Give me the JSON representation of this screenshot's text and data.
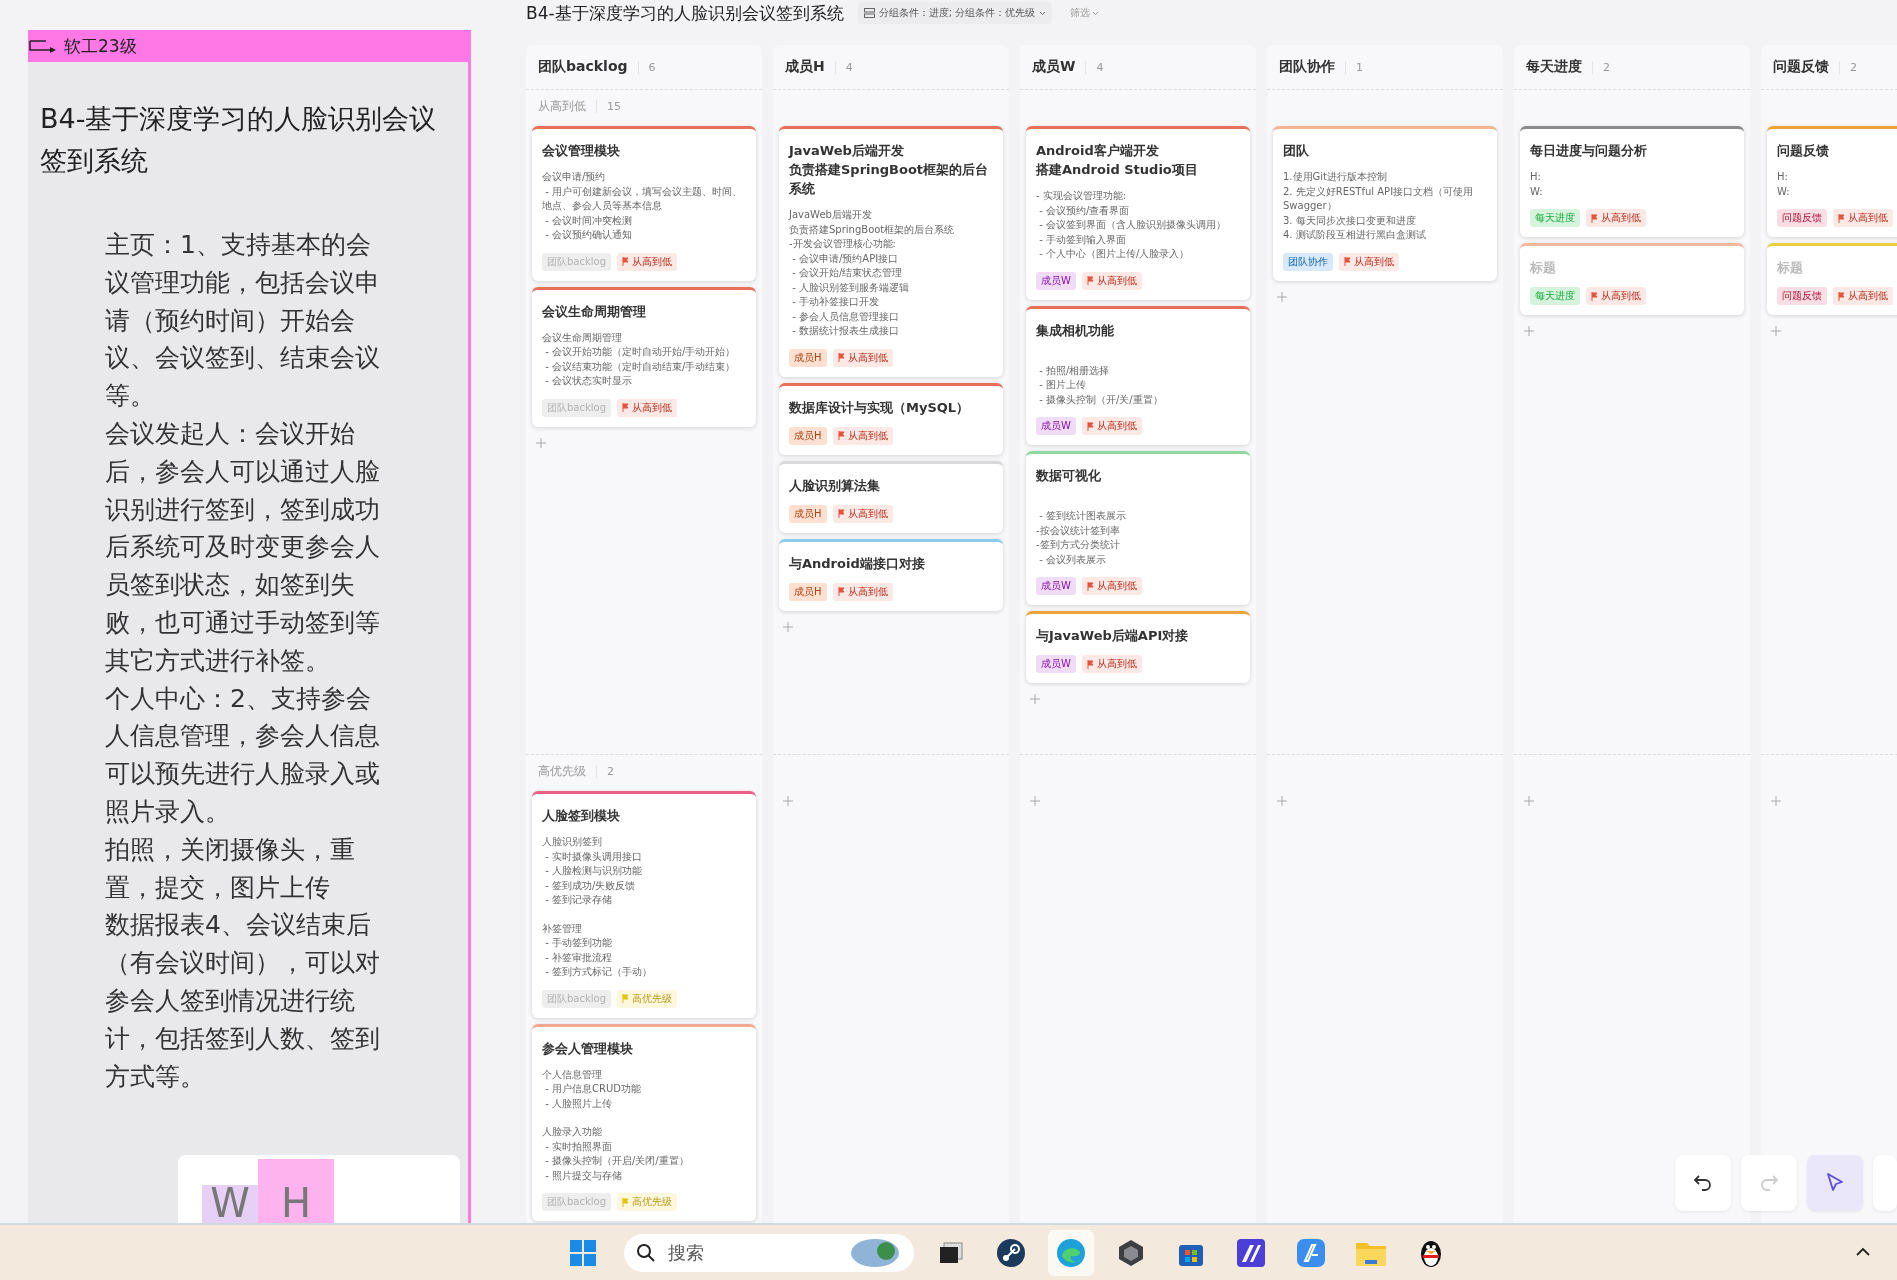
{
  "note_panel": {
    "header": "软工23级",
    "title": "B4-基于深度学习的人脸识别会议签到系统",
    "paragraphs": [
      "主页：1、支持基本的会议管理功能，包括会议申请（预约时间）开始会议、会议签到、结束会议等。",
      "会议发起人：会议开始后，参会人可以通过人脸识别进行签到，签到成功后系统可及时变更参会人员签到状态，如签到失败，也可通过手动签到等其它方式进行补签。",
      "个人中心：2、支持参会人信息管理，参会人信息可以预先进行人脸录入或照片录入。",
      "拍照，关闭摄像头，重置，提交，图片上传",
      "数据报表4、会议结束后（有会议时间），可以对参会人签到情况进行统计，包括签到人数、签到方式等。"
    ],
    "stickies": [
      {
        "label": "W",
        "color": "#e6d0f5"
      },
      {
        "label": "H",
        "color": "#ffb3ee"
      }
    ]
  },
  "board": {
    "title": "B4-基于深度学习的人脸识别会议签到系统",
    "group_by": "分组条件：进度; 分组条件：优先级",
    "filter": "筛选",
    "columns": [
      {
        "name": "团队backlog",
        "count": "6"
      },
      {
        "name": "成员H",
        "count": "4"
      },
      {
        "name": "成员W",
        "count": "4"
      },
      {
        "name": "团队协作",
        "count": "1"
      },
      {
        "name": "每天进度",
        "count": "2"
      },
      {
        "name": "问题反馈",
        "count": "2"
      }
    ],
    "lanes": [
      {
        "name": "从高到低",
        "count": "15",
        "cells": [
          [
            {
              "title": [
                "会议管理模块"
              ],
              "color": "#e8705a",
              "body": [
                [
                  "会议申请/预约",
                  " - 用户可创建新会议，填写会议主题、时间、地点、参会人员等基本信息",
                  " - 会议时间冲突检测",
                  " - 会议预约确认通知"
                ]
              ],
              "tags": [
                {
                  "kind": "group",
                  "label": "团队backlog",
                  "color": "#eeeeee"
                },
                {
                  "kind": "priority",
                  "label": "从高到低",
                  "color": "#e5533d"
                }
              ]
            },
            {
              "title": [
                "会议生命周期管理"
              ],
              "color": "#e8705a",
              "body": [
                [
                  "会议生命周期管理",
                  " - 会议开始功能（定时自动开始/手动开始）",
                  " - 会议结束功能（定时自动结束/手动结束）",
                  " - 会议状态实时显示"
                ]
              ],
              "tags": [
                {
                  "kind": "group",
                  "label": "团队backlog",
                  "color": "#eeeeee"
                },
                {
                  "kind": "priority",
                  "label": "从高到低",
                  "color": "#e5533d"
                }
              ]
            }
          ],
          [
            {
              "title": [
                "JavaWeb后端开发",
                "负责搭建SpringBoot框架的后台系统"
              ],
              "color": "#e8705a",
              "body": [
                [
                  "JavaWeb后端开发",
                  "负责搭建SpringBoot框架的后台系统",
                  "-开发会议管理核心功能:",
                  " - 会议申请/预约API接口",
                  " - 会议开始/结束状态管理",
                  " - 人脸识别签到服务端逻辑",
                  " - 手动补签接口开发",
                  " - 参会人员信息管理接口",
                  " - 数据统计报表生成接口"
                ]
              ],
              "tags": [
                {
                  "kind": "group",
                  "label": "成员H",
                  "color": "#fde0d2"
                },
                {
                  "kind": "priority",
                  "label": "从高到低",
                  "color": "#e5533d"
                }
              ]
            },
            {
              "title": [
                "数据库设计与实现（MySQL）"
              ],
              "color": "#e8705a",
              "tags": [
                {
                  "kind": "group",
                  "label": "成员H",
                  "color": "#fde0d2"
                },
                {
                  "kind": "priority",
                  "label": "从高到低",
                  "color": "#e5533d"
                }
              ]
            },
            {
              "title": [
                "人脸识别算法集"
              ],
              "color": "#d8d8d8",
              "tags": [
                {
                  "kind": "group",
                  "label": "成员H",
                  "color": "#fde0d2"
                },
                {
                  "kind": "priority",
                  "label": "从高到低",
                  "color": "#e5533d"
                }
              ]
            },
            {
              "title": [
                "与Android端接口对接"
              ],
              "color": "#8ccbef",
              "tags": [
                {
                  "kind": "group",
                  "label": "成员H",
                  "color": "#fde0d2"
                },
                {
                  "kind": "priority",
                  "label": "从高到低",
                  "color": "#e5533d"
                }
              ]
            }
          ],
          [
            {
              "title": [
                "Android客户端开发",
                "搭建Android Studio项目"
              ],
              "color": "#e8705a",
              "body": [
                [
                  "- 实现会议管理功能:",
                  " - 会议预约/查看界面",
                  " - 会议签到界面（含人脸识别摄像头调用）",
                  " - 手动签到输入界面",
                  " - 个人中心（图片上传/人脸录入）"
                ]
              ],
              "tags": [
                {
                  "kind": "group",
                  "label": "成员W",
                  "color": "#f0dcf6"
                },
                {
                  "kind": "priority",
                  "label": "从高到低",
                  "color": "#e5533d"
                }
              ]
            },
            {
              "title": [
                "集成相机功能"
              ],
              "color": "#e8705a",
              "spaced": true,
              "body": [
                [
                  " - 拍照/相册选择",
                  " - 图片上传",
                  " - 摄像头控制（开/关/重置）"
                ]
              ],
              "tags": [
                {
                  "kind": "group",
                  "label": "成员W",
                  "color": "#f0dcf6"
                },
                {
                  "kind": "priority",
                  "label": "从高到低",
                  "color": "#e5533d"
                }
              ]
            },
            {
              "title": [
                "数据可视化"
              ],
              "color": "#8fd9a0",
              "spaced": true,
              "body": [
                [
                  " - 签到统计图表展示",
                  "-按会议统计签到率",
                  "-签到方式分类统计",
                  " - 会议列表展示"
                ]
              ],
              "tags": [
                {
                  "kind": "group",
                  "label": "成员W",
                  "color": "#f0dcf6"
                },
                {
                  "kind": "priority",
                  "label": "从高到低",
                  "color": "#e5533d"
                }
              ]
            },
            {
              "title": [
                "与JavaWeb后端API对接"
              ],
              "color": "#eda23a",
              "tags": [
                {
                  "kind": "group",
                  "label": "成员W",
                  "color": "#f0dcf6"
                },
                {
                  "kind": "priority",
                  "label": "从高到低",
                  "color": "#e5533d"
                }
              ]
            }
          ],
          [
            {
              "title": [
                "团队"
              ],
              "color": "#f3b38e",
              "body": [
                [
                  "1.使用Git进行版本控制",
                  "2. 先定义好RESTful API接口文档（可使用Swagger）",
                  "3. 每天同步次接口变更和进度",
                  "4. 测试阶段互相进行黑白盒测试"
                ]
              ],
              "tags": [
                {
                  "kind": "group",
                  "label": "团队协作",
                  "color": "#d8eafa"
                },
                {
                  "kind": "priority",
                  "label": "从高到低",
                  "color": "#e5533d"
                }
              ]
            }
          ],
          [
            {
              "title": [
                "每日进度与问题分析"
              ],
              "color": "#8a8a8a",
              "body": [
                [
                  "H:",
                  "W:"
                ]
              ],
              "tags": [
                {
                  "kind": "group",
                  "label": "每天进度",
                  "color": "#d6f4dd"
                },
                {
                  "kind": "priority",
                  "label": "从高到低",
                  "color": "#e5533d"
                }
              ]
            },
            {
              "placeholder": "标题",
              "color": "#f3b8a0",
              "tags": [
                {
                  "kind": "group",
                  "label": "每天进度",
                  "color": "#d6f4dd"
                },
                {
                  "kind": "priority",
                  "label": "从高到低",
                  "color": "#e5533d"
                }
              ]
            }
          ],
          [
            {
              "title": [
                "问题反馈"
              ],
              "color": "#eda23a",
              "body": [
                [
                  "H:",
                  "W:"
                ]
              ],
              "tags": [
                {
                  "kind": "group",
                  "label": "问题反馈",
                  "color": "#fbdde4"
                },
                {
                  "kind": "priority",
                  "label": "从高到低",
                  "color": "#e5533d"
                }
              ]
            },
            {
              "placeholder": "标题",
              "color": "#e8d040",
              "tags": [
                {
                  "kind": "group",
                  "label": "问题反馈",
                  "color": "#fbdde4"
                },
                {
                  "kind": "priority",
                  "label": "从高到低",
                  "color": "#e5533d"
                }
              ]
            }
          ]
        ]
      },
      {
        "name": "高优先级",
        "count": "2",
        "cells": [
          [
            {
              "title": [
                "人脸签到模块"
              ],
              "color": "#ec5f86",
              "body": [
                [
                  "人脸识别签到",
                  " - 实时摄像头调用接口",
                  " - 人脸检测与识别功能",
                  " - 签到成功/失败反馈",
                  " - 签到记录存储"
                ],
                [
                  "补签管理",
                  " - 手动签到功能",
                  " - 补签审批流程",
                  " - 签到方式标记（手动）"
                ]
              ],
              "tags": [
                {
                  "kind": "group",
                  "label": "团队backlog",
                  "color": "#eeeeee"
                },
                {
                  "kind": "priority",
                  "label": "高优先级",
                  "color": "#e6c200"
                }
              ]
            },
            {
              "title": [
                "参会人管理模块"
              ],
              "color": "#f3a890",
              "body": [
                [
                  "个人信息管理",
                  " - 用户信息CRUD功能",
                  " - 人脸照片上传"
                ],
                [
                  "人脸录入功能",
                  " - 实时拍照界面",
                  " - 摄像头控制（开启/关闭/重置）",
                  " - 照片提交与存储"
                ]
              ],
              "tags": [
                {
                  "kind": "group",
                  "label": "团队backlog",
                  "color": "#eeeeee"
                },
                {
                  "kind": "priority",
                  "label": "高优先级",
                  "color": "#e6c200"
                }
              ]
            }
          ],
          [],
          [],
          [],
          [],
          []
        ]
      }
    ]
  },
  "canvas_tools": {
    "undo": {
      "disabled": false
    },
    "redo": {
      "disabled": true
    },
    "select": {
      "selected": true
    }
  },
  "taskbar": {
    "search": {
      "placeholder": "搜索"
    },
    "apps": [
      {
        "kind": "task-view",
        "selected": false
      },
      {
        "kind": "steam",
        "selected": false
      },
      {
        "kind": "edge",
        "selected": true
      },
      {
        "kind": "cube",
        "selected": false
      },
      {
        "kind": "store",
        "selected": false
      },
      {
        "kind": "purple-app",
        "selected": false
      },
      {
        "kind": "blue-app",
        "selected": false
      },
      {
        "kind": "folder",
        "selected": false
      },
      {
        "kind": "penguin",
        "selected": false
      }
    ]
  }
}
